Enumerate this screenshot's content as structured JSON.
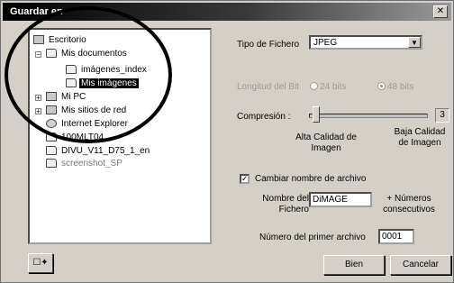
{
  "window": {
    "title": "Guardar en"
  },
  "tree": {
    "items": [
      {
        "label": "Escritorio",
        "icon": "desktop-icon"
      },
      {
        "label": "Mis documentos",
        "icon": "folder-icon"
      },
      {
        "label": "imágenes_index",
        "icon": "folder-icon"
      },
      {
        "label": "Mis imágenes",
        "icon": "folder-icon",
        "selected": true
      },
      {
        "label": "Mi PC",
        "icon": "computer-icon"
      },
      {
        "label": "Mis sitios de red",
        "icon": "network-icon"
      },
      {
        "label": "Internet Explorer",
        "icon": "ie-icon"
      },
      {
        "label": "100MLT04",
        "icon": "folder-icon"
      },
      {
        "label": "DIVU_V11_D75_1_en",
        "icon": "folder-icon"
      },
      {
        "label": "screenshot_SP",
        "icon": "folder-icon"
      }
    ]
  },
  "file_type": {
    "label": "Tipo de Fichero",
    "value": "JPEG"
  },
  "bit_depth": {
    "label": "Longitud del Bit",
    "opt24": "24 bits",
    "opt48": "48 bits"
  },
  "compression": {
    "label": "Compresión :",
    "value": "3",
    "left_caption": "Alta Calidad de Imagen",
    "right_caption": "Baja Calidad de Imagen"
  },
  "rename": {
    "checkbox_label": "Cambiar nombre de archivo",
    "name_label": "Nombre del Fichero",
    "name_value": "DiMAGE",
    "suffix_label": "+ Números consecutivos",
    "first_number_label": "Número del primer archivo",
    "first_number_value": "0001"
  },
  "buttons": {
    "ok": "Bien",
    "cancel": "Cancelar"
  }
}
